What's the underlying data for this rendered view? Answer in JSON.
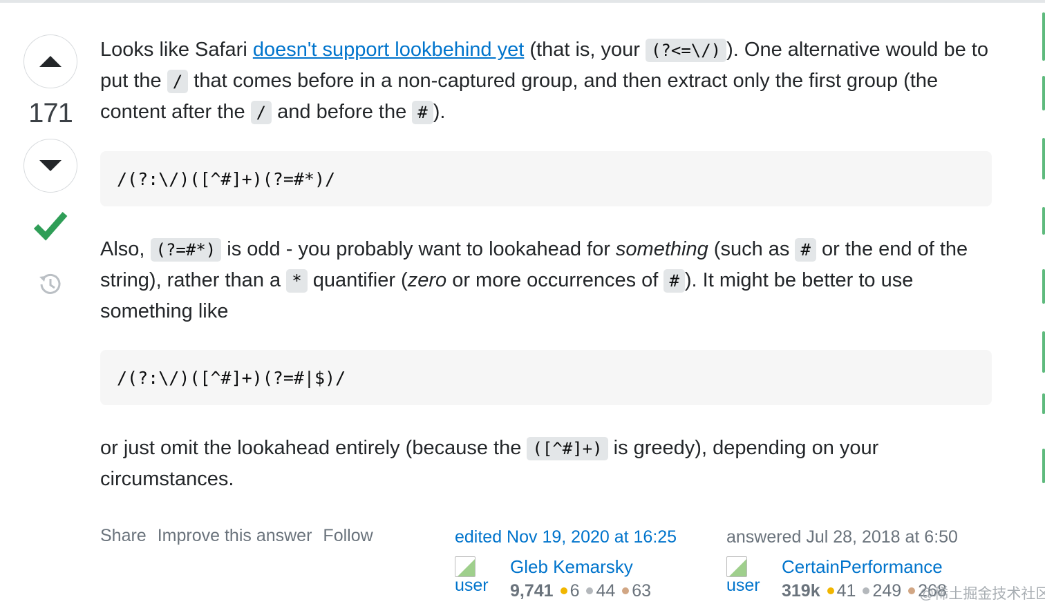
{
  "vote": {
    "count": "171"
  },
  "para1": {
    "t1": "Looks like Safari ",
    "link": "doesn't support lookbehind yet",
    "t2": " (that is, your ",
    "c1": "(?<=\\/)",
    "t3": "). One alternative would be to put the ",
    "c2": "/",
    "t4": " that comes before in a non-captured group, and then extract only the first group (the content after the ",
    "c3": "/",
    "t5": " and before the ",
    "c4": "#",
    "t6": ")."
  },
  "code1": "/(?:\\/)([^#]+)(?=#*)/",
  "para2": {
    "t1": "Also, ",
    "c1": "(?=#*)",
    "t2": " is odd - you probably want to lookahead for ",
    "em1": "something",
    "t3": " (such as ",
    "c2": "#",
    "t4": " or the end of the string), rather than a ",
    "c3": "*",
    "t5": " quantifier (",
    "em2": "zero",
    "t6": " or more occurrences of ",
    "c4": "#",
    "t7": "). It might be better to use something like"
  },
  "code2": "/(?:\\/)([^#]+)(?=#|$)/",
  "para3": {
    "t1": "or just omit the lookahead entirely (because the ",
    "c1": "([^#]+)",
    "t2": " is greedy), depending on your circumstances."
  },
  "menu": {
    "share": "Share",
    "improve": "Improve this answer",
    "follow": "Follow"
  },
  "editor": {
    "when": "edited Nov 19, 2020 at 16:25",
    "avatar_alt": "user",
    "name": "Gleb Kemarsky",
    "rep": "9,741",
    "gold": "6",
    "silver": "44",
    "bronze": "63"
  },
  "answerer": {
    "when": "answered Jul 28, 2018 at 6:50",
    "avatar_alt": "user",
    "name": "CertainPerformance",
    "rep": "319k",
    "gold": "41",
    "silver": "249",
    "bronze": "268"
  },
  "watermark": "@稀土掘金技术社区",
  "colors": {
    "link": "#0074cc",
    "accepted": "#2f9e57",
    "code_bg": "#e3e6e8",
    "block_bg": "#f6f6f6"
  },
  "icons": [
    "upvote-icon",
    "downvote-icon",
    "accepted-check-icon",
    "history-icon",
    "broken-image-icon"
  ]
}
